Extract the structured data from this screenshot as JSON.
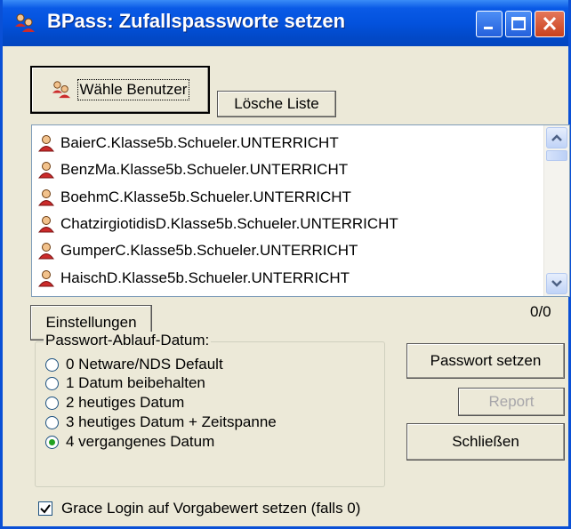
{
  "window": {
    "title": "BPass: Zufallspassworte setzen",
    "icon": "users-icon",
    "controls": [
      "minimize-icon",
      "maximize-icon",
      "close-icon"
    ]
  },
  "buttons": {
    "select_users": "Wähle Benutzer",
    "clear_list": "Lösche Liste",
    "settings": "Einstellungen",
    "set_password": "Passwort setzen",
    "report": "Report",
    "close": "Schließen"
  },
  "user_list": {
    "items": [
      "BaierC.Klasse5b.Schueler.UNTERRICHT",
      "BenzMa.Klasse5b.Schueler.UNTERRICHT",
      "BoehmC.Klasse5b.Schueler.UNTERRICHT",
      "ChatzirgiotidisD.Klasse5b.Schueler.UNTERRICHT",
      "GumperC.Klasse5b.Schueler.UNTERRICHT",
      "HaischD.Klasse5b.Schueler.UNTERRICHT"
    ],
    "item_icon": "user-icon"
  },
  "counter": "0/0",
  "expiry_group": {
    "title": "Passwort-Ablauf-Datum:",
    "options": [
      "0 Netware/NDS Default",
      "1 Datum beibehalten",
      "2 heutiges Datum",
      "3 heutiges Datum + Zeitspanne",
      "4 vergangenes Datum"
    ],
    "selected_index": 4
  },
  "grace_login": {
    "label": "Grace Login auf Vorgabewert setzen (falls 0)",
    "checked": true
  },
  "colors": {
    "titlebar": "#0352dd",
    "background": "#ece9d8",
    "close_button": "#c9411d",
    "accent_green": "#21a121"
  }
}
